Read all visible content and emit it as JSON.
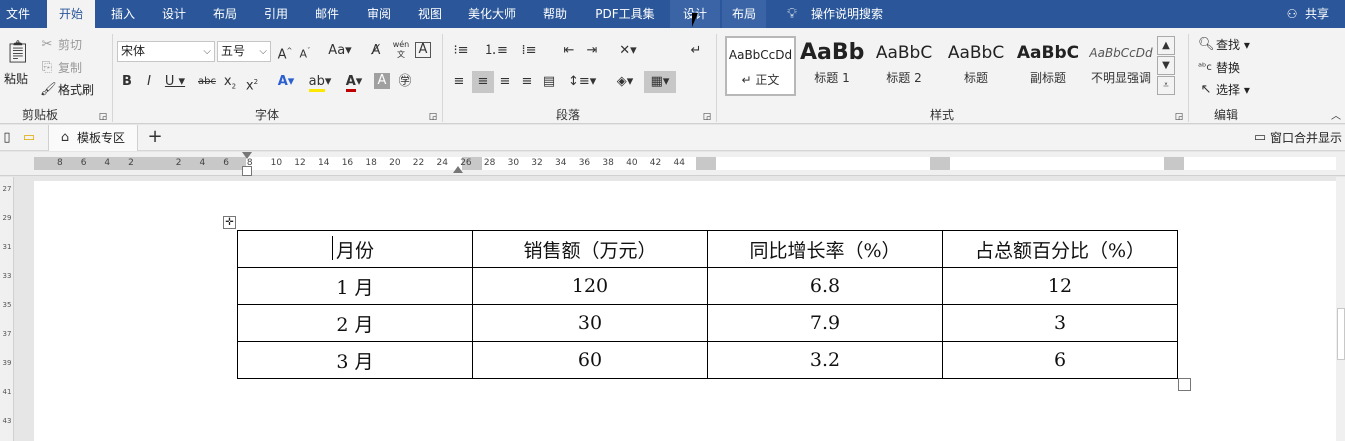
{
  "menubar": {
    "tabs": [
      "文件",
      "开始",
      "插入",
      "设计",
      "布局",
      "引用",
      "邮件",
      "审阅",
      "视图",
      "美化大师",
      "帮助",
      "PDF工具集",
      "设计",
      "布局"
    ],
    "tell_me": "操作说明搜索",
    "share": "共享"
  },
  "ribbon": {
    "clipboard": {
      "paste": "粘贴",
      "cut": "剪切",
      "copy": "复制",
      "format_painter": "格式刷",
      "label": "剪贴板"
    },
    "font": {
      "font_name": "宋体",
      "font_size": "五号",
      "label": "字体",
      "wen": "wén"
    },
    "paragraph": {
      "label": "段落"
    },
    "styles": {
      "items": [
        {
          "sample": "AaBbCcDd",
          "name": "正文"
        },
        {
          "sample": "AaBb",
          "name": "标题 1"
        },
        {
          "sample": "AaBbC",
          "name": "标题 2"
        },
        {
          "sample": "AaBbC",
          "name": "标题"
        },
        {
          "sample": "AaBbC",
          "name": "副标题"
        },
        {
          "sample": "AaBbCcDd",
          "name": "不明显强调"
        }
      ],
      "label": "样式"
    },
    "editing": {
      "find": "查找",
      "replace": "替换",
      "select": "选择",
      "label": "编辑"
    }
  },
  "tabbar": {
    "template_tab": "模板专区",
    "merge_windows": "窗口合并显示"
  },
  "ruler": {
    "h_ticks": [
      "8",
      "6",
      "4",
      "2",
      "2",
      "4",
      "6",
      "8",
      "10",
      "12",
      "14",
      "16",
      "18",
      "20",
      "22",
      "24",
      "26",
      "28",
      "30",
      "32",
      "34",
      "36",
      "38",
      "40",
      "42",
      "44"
    ],
    "v_ticks": [
      "27",
      "29",
      "31",
      "33",
      "35",
      "37",
      "39",
      "41",
      "43"
    ]
  },
  "table": {
    "header": [
      "月份",
      "销售额（万元）",
      "同比增长率（%）",
      "占总额百分比（%）"
    ],
    "rows": [
      [
        "1 月",
        "120",
        "6.8",
        "12"
      ],
      [
        "2 月",
        "30",
        "7.9",
        "3"
      ],
      [
        "3 月",
        "60",
        "3.2",
        "6"
      ]
    ]
  }
}
